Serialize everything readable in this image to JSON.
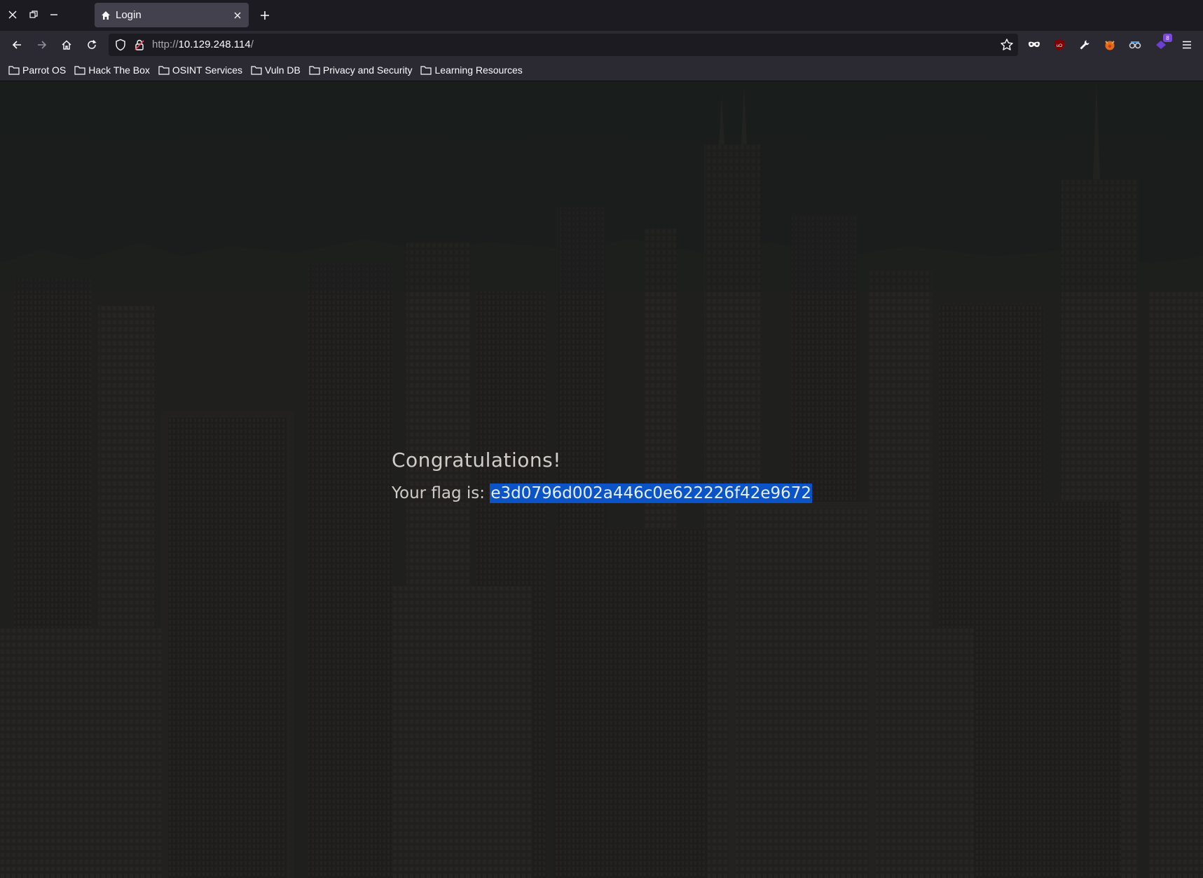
{
  "browser": {
    "tab": {
      "title": "Login"
    },
    "url": {
      "scheme": "http://",
      "host": "10.129.248.114",
      "path": "/"
    },
    "extensions_badge": "8",
    "bookmarks": [
      {
        "label": "Parrot OS"
      },
      {
        "label": "Hack The Box"
      },
      {
        "label": "OSINT Services"
      },
      {
        "label": "Vuln DB"
      },
      {
        "label": "Privacy and Security"
      },
      {
        "label": "Learning Resources"
      }
    ]
  },
  "page": {
    "heading": "Congratulations!",
    "flag_prefix": "Your flag is:",
    "flag_value": "e3d0796d002a446c0e622226f42e9672"
  },
  "colors": {
    "selection": "#0a54c7",
    "text": "#d0ccc6",
    "toolbar": "#2b2a33",
    "tabstrip": "#1c1b22"
  }
}
